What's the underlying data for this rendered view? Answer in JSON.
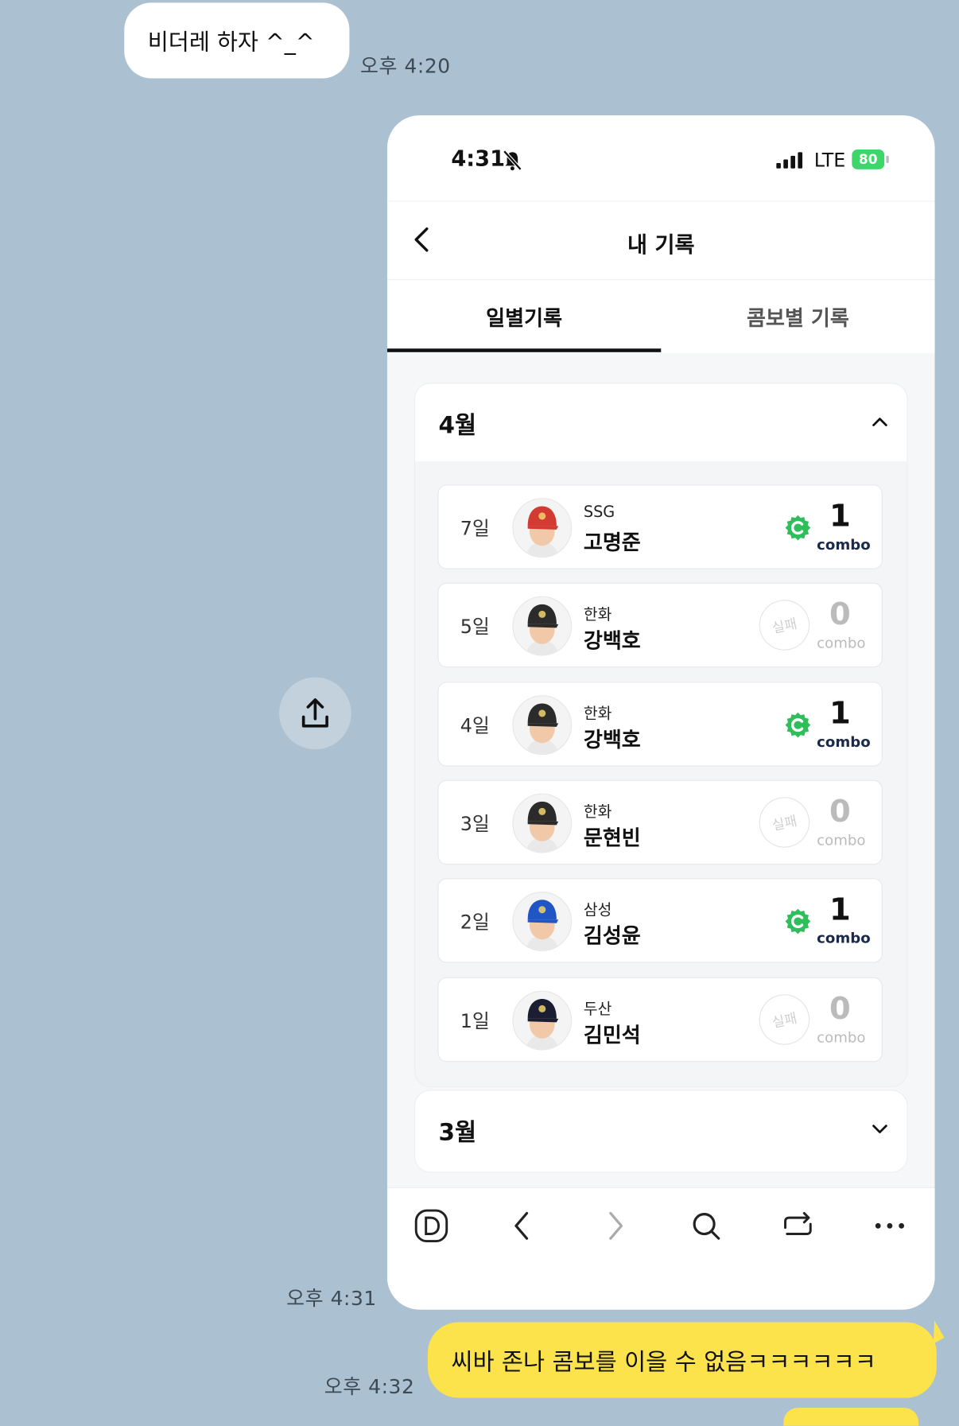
{
  "chat": {
    "incoming_message": "비더레 하자 ^_^",
    "incoming_time": "오후 4:20",
    "image_time": "오후 4:31",
    "outgoing_message": "씨바 존나 콤보를 이을 수 없음ㅋㅋㅋㅋㅋㅋ",
    "outgoing_time": "오후 4:32"
  },
  "phone": {
    "status": {
      "time": "4:31",
      "network": "LTE",
      "battery": "80"
    },
    "header": {
      "title": "내 기록"
    },
    "tabs": [
      {
        "label": "일별기록",
        "active": true
      },
      {
        "label": "콤보별 기록",
        "active": false
      }
    ],
    "months": [
      {
        "label": "4월",
        "expanded": true,
        "records": [
          {
            "day": "7일",
            "team": "SSG",
            "player": "고명준",
            "combo": "1",
            "combo_label": "combo",
            "success": true,
            "cap_color": "#d23a32"
          },
          {
            "day": "5일",
            "team": "한화",
            "player": "강백호",
            "combo": "0",
            "combo_label": "combo",
            "success": false,
            "fail_label": "실패",
            "cap_color": "#2b2b2b"
          },
          {
            "day": "4일",
            "team": "한화",
            "player": "강백호",
            "combo": "1",
            "combo_label": "combo",
            "success": true,
            "cap_color": "#2b2b2b"
          },
          {
            "day": "3일",
            "team": "한화",
            "player": "문현빈",
            "combo": "0",
            "combo_label": "combo",
            "success": false,
            "fail_label": "실패",
            "cap_color": "#2b2b2b"
          },
          {
            "day": "2일",
            "team": "삼성",
            "player": "김성윤",
            "combo": "1",
            "combo_label": "combo",
            "success": true,
            "cap_color": "#1f55c4"
          },
          {
            "day": "1일",
            "team": "두산",
            "player": "김민석",
            "combo": "0",
            "combo_label": "combo",
            "success": false,
            "fail_label": "실패",
            "cap_color": "#1b1e33"
          }
        ]
      },
      {
        "label": "3월",
        "expanded": false
      }
    ],
    "bottom_nav": [
      "d-logo-icon",
      "back-icon",
      "forward-icon",
      "search-icon",
      "share-icon",
      "more-icon"
    ]
  },
  "colors": {
    "chat_bg": "#abc1d1",
    "outgoing_bubble": "#fce34b",
    "combo_green": "#2fbf5a"
  }
}
